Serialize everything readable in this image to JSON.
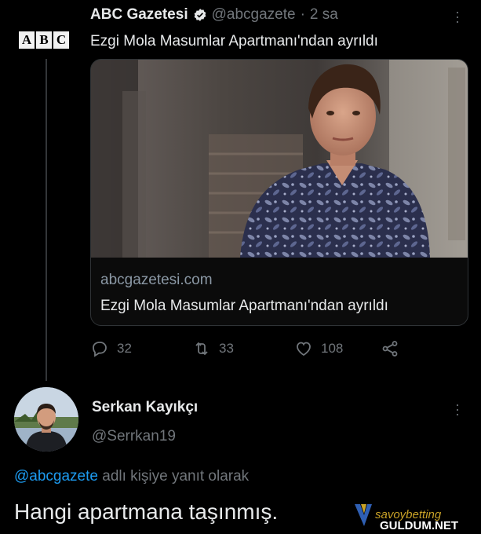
{
  "tweet1": {
    "logo_letters": [
      "A",
      "B",
      "C"
    ],
    "display_name": "ABC Gazetesi",
    "handle": "@abcgazete",
    "separator": "·",
    "time": "2 sa",
    "text": "Ezgi Mola Masumlar Apartmanı'ndan ayrıldı",
    "card": {
      "domain": "abcgazetesi.com",
      "title": "Ezgi Mola Masumlar Apartmanı'ndan ayrıldı"
    },
    "actions": {
      "replies": "32",
      "retweets": "33",
      "likes": "108"
    }
  },
  "tweet2": {
    "display_name": "Serkan Kayıkçı",
    "handle": "@Serrkan19",
    "reply_prefix_handle": "@abcgazete",
    "reply_suffix": "adlı kişiye yanıt olarak",
    "text": "Hangi apartmana taşınmış."
  },
  "watermark": {
    "brand": "savoybetting",
    "site": "GULDUM.NET"
  },
  "colors": {
    "background": "#000000",
    "text_primary": "#e7e9ea",
    "text_secondary": "#71767b",
    "link": "#1d9bf0"
  }
}
